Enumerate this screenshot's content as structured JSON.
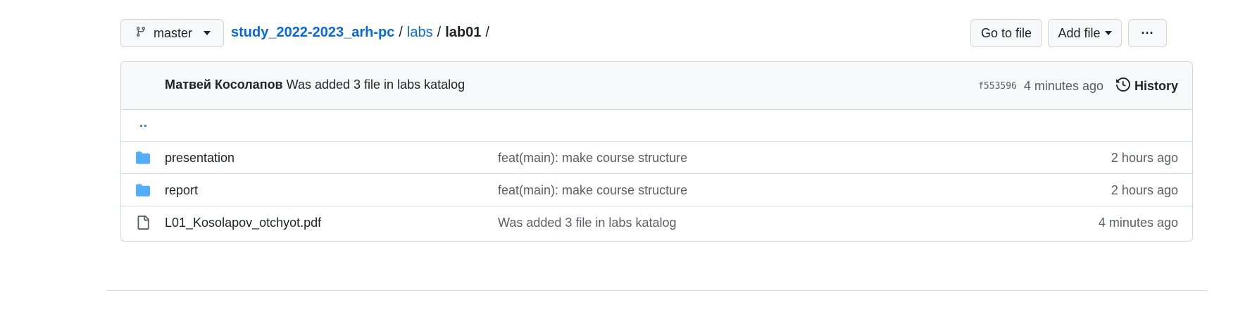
{
  "branch": {
    "label": "master"
  },
  "breadcrumb": {
    "repo": "study_2022-2023_arh-pc",
    "sep1": "/",
    "folder": "labs",
    "sep2": "/",
    "current": "lab01",
    "sep3": "/"
  },
  "actions": {
    "go_to_file": "Go to file",
    "add_file": "Add file",
    "more": "···"
  },
  "latest_commit": {
    "author": "Матвей Косолапов",
    "message": "Was added 3 file in labs katalog",
    "sha": "f553596",
    "time": "4 minutes ago",
    "history_label": "History"
  },
  "parent_dir": "..",
  "files": [
    {
      "type": "folder",
      "name": "presentation",
      "message": "feat(main): make course structure",
      "age": "2 hours ago"
    },
    {
      "type": "folder",
      "name": "report",
      "message": "feat(main): make course structure",
      "age": "2 hours ago"
    },
    {
      "type": "file",
      "name": "L01_Kosolapov_otchyot.pdf",
      "message": "Was added 3 file in labs katalog",
      "age": "4 minutes ago"
    }
  ],
  "colors": {
    "link": "#0969da",
    "folder": "#54aeff",
    "border": "#d0d7de",
    "muted": "#57606a"
  }
}
